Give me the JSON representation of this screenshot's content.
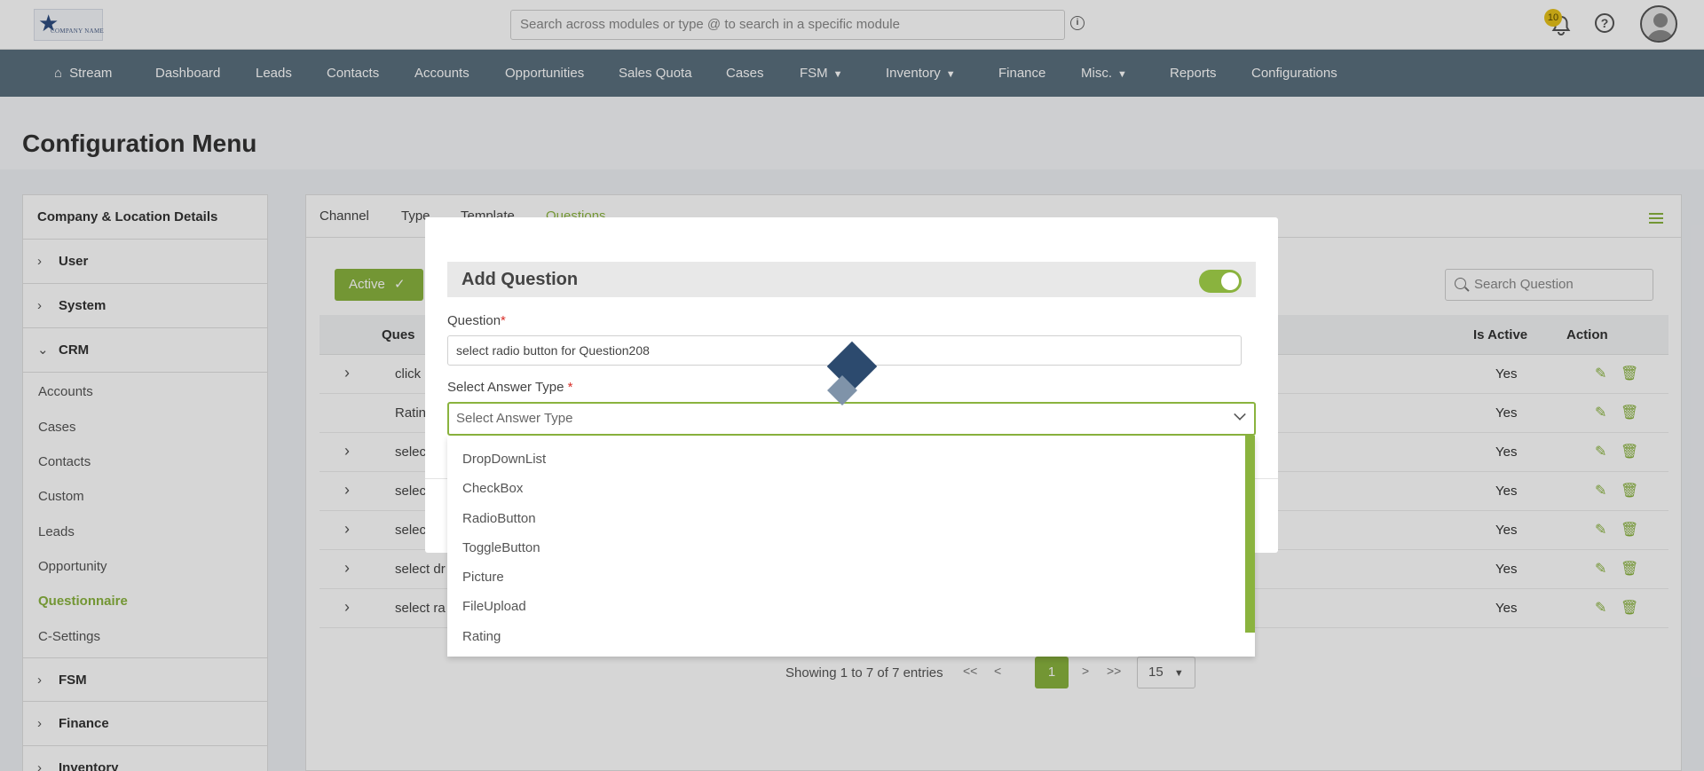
{
  "topbar": {
    "logo_text": "COMPANY NAME",
    "search_placeholder": "Search across modules or type @ to search in a specific module",
    "notification_count": "10"
  },
  "nav": {
    "items": [
      {
        "label": "Stream"
      },
      {
        "label": "Dashboard"
      },
      {
        "label": "Leads"
      },
      {
        "label": "Contacts"
      },
      {
        "label": "Accounts"
      },
      {
        "label": "Opportunities"
      },
      {
        "label": "Sales Quota"
      },
      {
        "label": "Cases"
      },
      {
        "label": "FSM"
      },
      {
        "label": "Inventory"
      },
      {
        "label": "Finance"
      },
      {
        "label": "Misc."
      },
      {
        "label": "Reports"
      },
      {
        "label": "Configurations"
      }
    ]
  },
  "page": {
    "title": "Configuration Menu"
  },
  "sidebar": {
    "sections": [
      {
        "label": "Company & Location Details"
      },
      {
        "label": "User"
      },
      {
        "label": "System"
      },
      {
        "label": "CRM"
      },
      {
        "label": "FSM"
      },
      {
        "label": "Finance"
      },
      {
        "label": "Inventory"
      }
    ],
    "crm_items": [
      {
        "label": "Accounts"
      },
      {
        "label": "Cases"
      },
      {
        "label": "Contacts"
      },
      {
        "label": "Custom"
      },
      {
        "label": "Leads"
      },
      {
        "label": "Opportunity"
      },
      {
        "label": "Questionnaire"
      },
      {
        "label": "C-Settings"
      }
    ]
  },
  "tabs": [
    {
      "label": "Channel"
    },
    {
      "label": "Type"
    },
    {
      "label": "Template"
    },
    {
      "label": "Questions"
    }
  ],
  "toolbar": {
    "active_label": "Active",
    "search_placeholder": "Search Question"
  },
  "table": {
    "headers": {
      "question": "Ques",
      "is_active": "Is Active",
      "action": "Action"
    },
    "rows": [
      {
        "question": "click",
        "is_active": "Yes"
      },
      {
        "question": "Ratin",
        "is_active": "Yes"
      },
      {
        "question": "selec",
        "is_active": "Yes"
      },
      {
        "question": "selec",
        "is_active": "Yes"
      },
      {
        "question": "selec",
        "is_active": "Yes"
      },
      {
        "question": "select dr",
        "is_active": "Yes"
      },
      {
        "question": "select ra",
        "is_active": "Yes"
      }
    ]
  },
  "pagination": {
    "info": "Showing 1 to 7 of 7 entries",
    "first": "<<",
    "prev": "<",
    "current": "1",
    "next": ">",
    "last": ">>",
    "page_size": "15"
  },
  "modal": {
    "title": "Add Question",
    "question_label": "Question",
    "question_value": "select radio button for Question208",
    "answer_type_label": "Select Answer Type ",
    "answer_type_placeholder": "Select Answer Type",
    "required_mark": "*"
  },
  "dropdown": {
    "options": [
      "DropDownList",
      "CheckBox",
      "RadioButton",
      "ToggleButton",
      "Picture",
      "FileUpload",
      "Rating"
    ]
  },
  "colors": {
    "accent": "#8ab33e",
    "nav_bg": "#5a6f7e"
  }
}
